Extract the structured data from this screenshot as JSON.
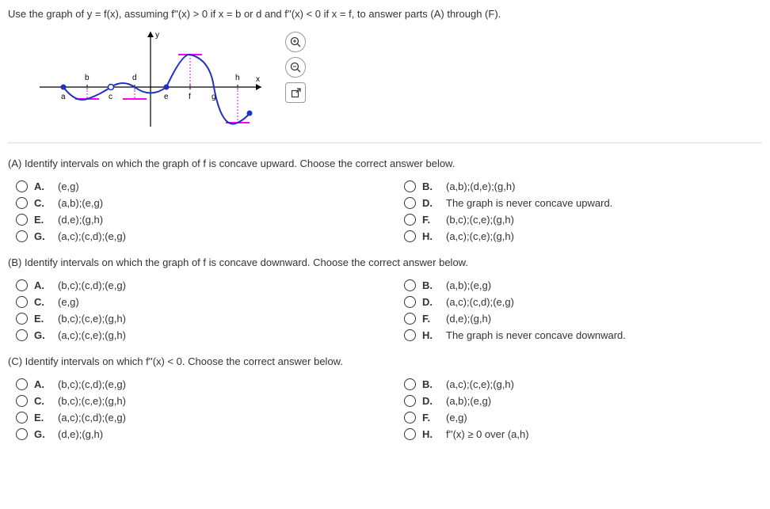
{
  "prompt": "Use the graph of y = f(x), assuming f''(x) > 0 if x = b or d and f''(x) < 0 if x = f, to answer parts (A) through (F).",
  "graph": {
    "x_points": [
      "a",
      "b",
      "c",
      "d",
      "e",
      "f",
      "g",
      "h"
    ],
    "y_label": "y",
    "x_label": "x"
  },
  "sections": [
    {
      "header": "(A) Identify intervals on which the graph of f is concave upward. Choose the correct answer below.",
      "options": [
        {
          "letter": "A.",
          "text": "(e,g)"
        },
        {
          "letter": "B.",
          "text": "(a,b);(d,e);(g,h)"
        },
        {
          "letter": "C.",
          "text": "(a,b);(e,g)"
        },
        {
          "letter": "D.",
          "text": "The graph is never concave upward."
        },
        {
          "letter": "E.",
          "text": "(d,e);(g,h)"
        },
        {
          "letter": "F.",
          "text": "(b,c);(c,e);(g,h)"
        },
        {
          "letter": "G.",
          "text": "(a,c);(c,d);(e,g)"
        },
        {
          "letter": "H.",
          "text": "(a,c);(c,e);(g,h)"
        }
      ]
    },
    {
      "header": "(B) Identify intervals on which the graph of f is concave downward. Choose the correct answer below.",
      "options": [
        {
          "letter": "A.",
          "text": "(b,c);(c,d);(e,g)"
        },
        {
          "letter": "B.",
          "text": "(a,b);(e,g)"
        },
        {
          "letter": "C.",
          "text": "(e,g)"
        },
        {
          "letter": "D.",
          "text": "(a,c);(c,d);(e,g)"
        },
        {
          "letter": "E.",
          "text": "(b,c);(c,e);(g,h)"
        },
        {
          "letter": "F.",
          "text": "(d,e);(g,h)"
        },
        {
          "letter": "G.",
          "text": "(a,c);(c,e);(g,h)"
        },
        {
          "letter": "H.",
          "text": "The graph is never concave downward."
        }
      ]
    },
    {
      "header": "(C) Identify intervals on which f''(x) < 0. Choose the correct answer below.",
      "options": [
        {
          "letter": "A.",
          "text": "(b,c);(c,d);(e,g)"
        },
        {
          "letter": "B.",
          "text": "(a,c);(c,e);(g,h)"
        },
        {
          "letter": "C.",
          "text": "(b,c);(c,e);(g,h)"
        },
        {
          "letter": "D.",
          "text": "(a,b);(e,g)"
        },
        {
          "letter": "E.",
          "text": "(a,c);(c,d);(e,g)"
        },
        {
          "letter": "F.",
          "text": "(e,g)"
        },
        {
          "letter": "G.",
          "text": "(d,e);(g,h)"
        },
        {
          "letter": "H.",
          "text": "f''(x) ≥ 0 over (a,h)"
        }
      ]
    }
  ]
}
